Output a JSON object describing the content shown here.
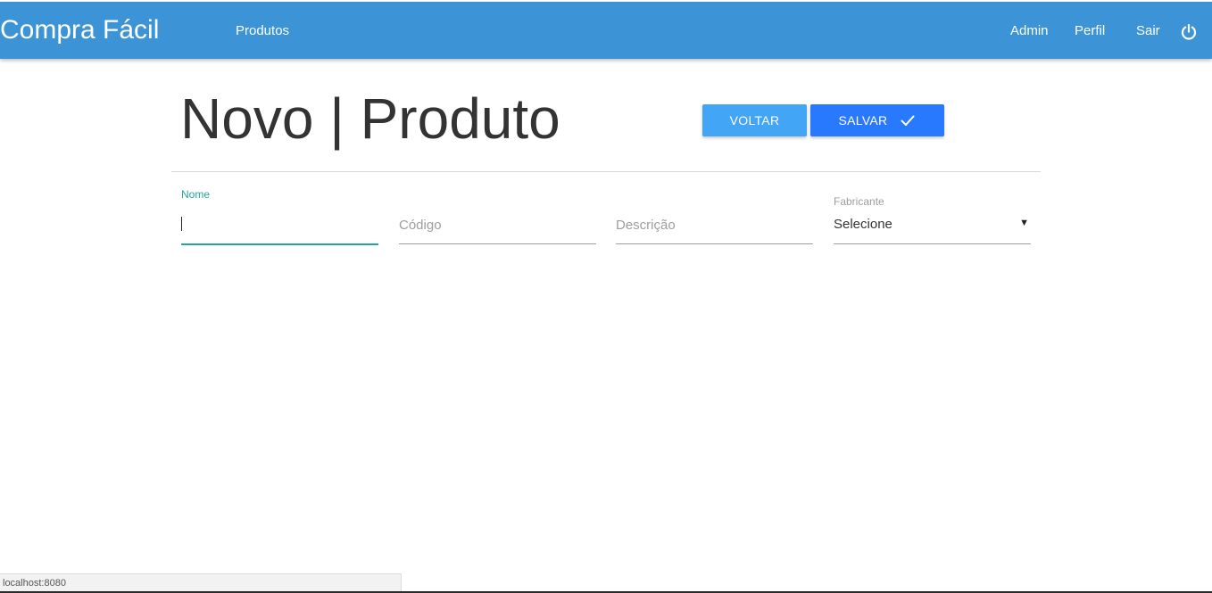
{
  "navbar": {
    "brand": "Compra Fácil",
    "links": [
      "Produtos"
    ],
    "right_links": [
      "Admin",
      "Perfil",
      "Sair"
    ],
    "power_icon": "power-icon",
    "background": "#3c94d6"
  },
  "page": {
    "title": "Novo | Produto"
  },
  "buttons": {
    "voltar": "VOLTAR",
    "salvar": "SALVAR",
    "salvar_icon": "check-icon",
    "voltar_color": "#42a5f5",
    "salvar_color": "#2979ff"
  },
  "form": {
    "nome": {
      "label": "Nome",
      "value": ""
    },
    "codigo": {
      "placeholder": "Código",
      "value": ""
    },
    "descricao": {
      "placeholder": "Descrição",
      "value": ""
    },
    "fabricante": {
      "label": "Fabricante",
      "selected": "Selecione"
    },
    "accent_color": "#26a69a"
  },
  "status_bar": {
    "url": "localhost:8080"
  }
}
